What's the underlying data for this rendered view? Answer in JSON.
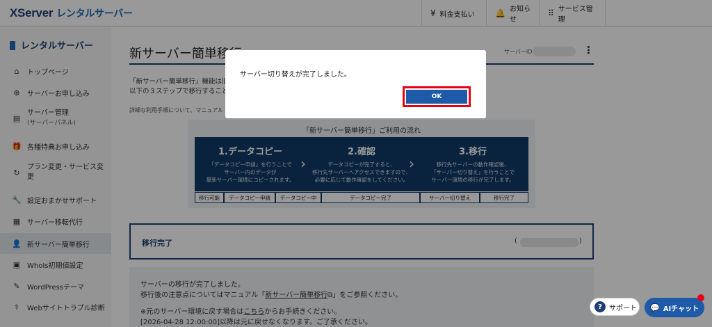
{
  "header": {
    "logo": "XServer",
    "logo_sub": "レンタルサーバー",
    "nav": [
      {
        "icon": "yen-icon",
        "glyph": "¥",
        "label": "料金支払い"
      },
      {
        "icon": "bell-icon",
        "glyph": "🔔",
        "label": "お知らせ"
      },
      {
        "icon": "grid-icon",
        "glyph": "⠿",
        "label": "サービス管理"
      }
    ]
  },
  "sidebar": {
    "title": "レンタルサーバー",
    "items": [
      {
        "label": "トップページ",
        "glyph": "⌂"
      },
      {
        "label": "サーバーお申し込み",
        "glyph": "⊕"
      },
      {
        "label": "サーバー管理",
        "sub": "(サーバーパネル)",
        "glyph": "▤"
      },
      {
        "label": "各種特典お申し込み",
        "glyph": "🎁"
      },
      {
        "label": "プラン変更・サービス変",
        "label2": "更",
        "glyph": "↻"
      },
      {
        "label": "設定おまかせサポート",
        "glyph": "🔧"
      },
      {
        "label": "サーバー移転代行",
        "glyph": "▦"
      },
      {
        "label": "新サーバー簡単移行",
        "glyph": "👤"
      },
      {
        "label": "WhoIs初期値設定",
        "glyph": "▣"
      },
      {
        "label": "WordPressテーマ",
        "glyph": "✎"
      },
      {
        "label": "Webサイトトラブル診断",
        "glyph": "⚕"
      }
    ]
  },
  "main": {
    "page_title": "新サーバー簡単移行",
    "server_id_label": "サーバーID",
    "intro_line1": "「新サーバー簡単移行」機能は旧",
    "intro_line2": "以下の３ステップで移行することが",
    "detail": "詳細な利用手順について、マニュアル",
    "flow": {
      "title": "「新サーバー簡単移行」ご利用の流れ",
      "steps": [
        {
          "title": "1.データコピー",
          "desc1": "「データコピー申請」を行うことで",
          "desc2": "サーバー内のデータが",
          "desc3": "最新サーバー環境にコピーされます。"
        },
        {
          "title": "2.確認",
          "desc1": "データコピーが完了すると、",
          "desc2": "移行先サーバーへアクセスできますので、",
          "desc3": "必要に応じて動作確認をしてください。"
        },
        {
          "title": "3.移行",
          "desc1": "移行先サーバーの動作確認後、",
          "desc2": "「サーバー切り替え」を行うことで",
          "desc3": "サーバー環境の移行が完了します。"
        }
      ],
      "stages": [
        "移行可能",
        "データコピー申請",
        "データコピー中",
        "データコピー完了",
        "サーバー切り替え",
        "移行完了"
      ]
    },
    "status": {
      "label": "移行完了",
      "paren_open": "(",
      "paren_close": ")"
    },
    "info": {
      "line1": "サーバーの移行が完了しました。",
      "line2_pre": "移行後の注意点についてはマニュアル「",
      "line2_link": "新サーバー簡単移行",
      "line2_post": "」をご参照ください。",
      "line3_pre": "※元のサーバー環境に戻す場合は",
      "line3_link": "こちら",
      "line3_post": "からお手続きください。",
      "line4": "[2026-04-28 12:00:00]以降は元に戻せなくなります。ご了承ください。"
    }
  },
  "modal": {
    "message": "サーバー切り替えが完了しました。",
    "ok_label": "OK"
  },
  "widgets": {
    "support_label": "サポート",
    "ai_label": "AIチャット"
  }
}
